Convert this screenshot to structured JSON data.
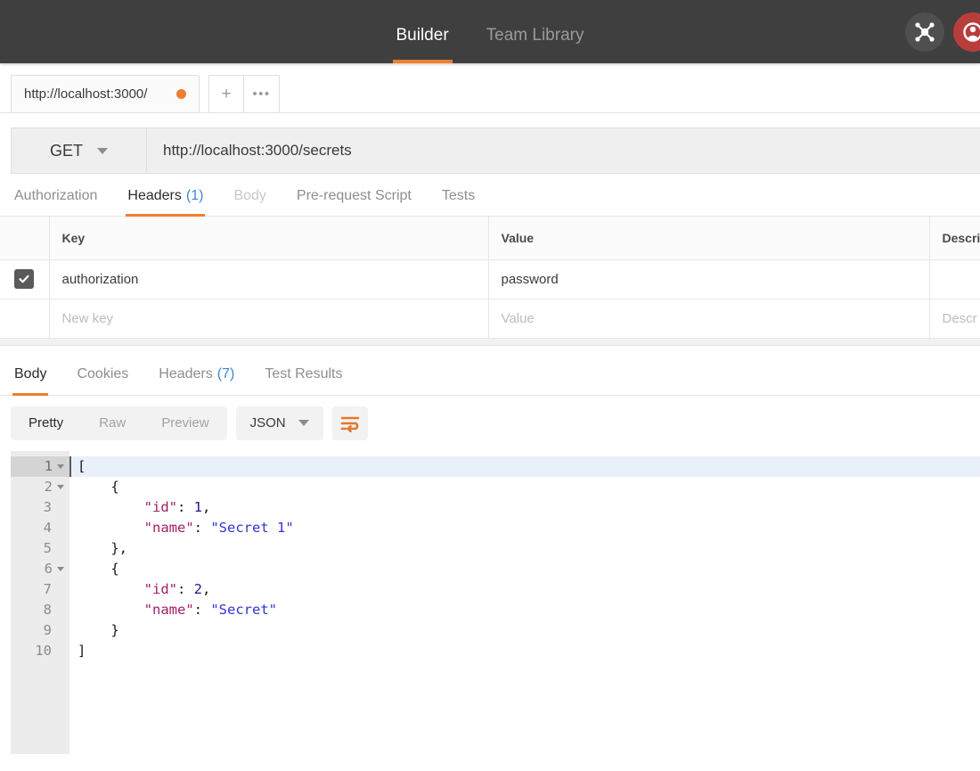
{
  "topbar": {
    "nav": [
      {
        "label": "Builder",
        "active": true
      },
      {
        "label": "Team Library",
        "active": false
      }
    ],
    "icons": [
      {
        "name": "network-graph-icon",
        "color": "#4f4f4f"
      },
      {
        "name": "user-avatar-icon",
        "color": "#b93d3d"
      }
    ],
    "accent_color": "#ef7e2f",
    "background_color": "#3f3f3f"
  },
  "request_tabs": {
    "open_tab_label": "http://localhost:3000/",
    "unsaved_indicator_color": "#ef7e2f",
    "new_tab_label": "+",
    "more_label": "•••"
  },
  "url_bar": {
    "method": "GET",
    "url": "http://localhost:3000/secrets"
  },
  "request_subtabs": [
    {
      "label": "Authorization",
      "count": "",
      "state": "normal"
    },
    {
      "label": "Headers",
      "count": "(1)",
      "state": "active"
    },
    {
      "label": "Body",
      "count": "",
      "state": "disabled"
    },
    {
      "label": "Pre-request Script",
      "count": "",
      "state": "normal"
    },
    {
      "label": "Tests",
      "count": "",
      "state": "normal"
    }
  ],
  "headers_table": {
    "columns": [
      "",
      "Key",
      "Value",
      "Descrip"
    ],
    "rows": [
      {
        "checked": true,
        "key": "authorization",
        "value": "password",
        "description": ""
      }
    ],
    "new_row": {
      "key_placeholder": "New key",
      "value_placeholder": "Value",
      "description_placeholder": "Descr"
    }
  },
  "response_tabs": [
    {
      "label": "Body",
      "count": "",
      "active": true
    },
    {
      "label": "Cookies",
      "count": "",
      "active": false
    },
    {
      "label": "Headers",
      "count": "(7)",
      "active": false
    },
    {
      "label": "Test Results",
      "count": "",
      "active": false
    }
  ],
  "response_toolbar": {
    "view_modes": [
      {
        "label": "Pretty",
        "active": true
      },
      {
        "label": "Raw",
        "active": false
      },
      {
        "label": "Preview",
        "active": false
      }
    ],
    "language": "JSON",
    "wrap_icon": "word-wrap-icon"
  },
  "response_body": {
    "line_numbers": [
      "1",
      "2",
      "3",
      "4",
      "5",
      "6",
      "7",
      "8",
      "9",
      "10"
    ],
    "foldable_lines": [
      "1",
      "2",
      "6"
    ],
    "active_line": "1",
    "lines": [
      {
        "num": "1",
        "tokens": [
          {
            "t": "p",
            "v": "["
          }
        ]
      },
      {
        "num": "2",
        "tokens": [
          {
            "t": "p",
            "v": "    {"
          }
        ]
      },
      {
        "num": "3",
        "tokens": [
          {
            "t": "k",
            "v": "        \"id\""
          },
          {
            "t": "p",
            "v": ": "
          },
          {
            "t": "n",
            "v": "1"
          },
          {
            "t": "p",
            "v": ","
          }
        ]
      },
      {
        "num": "4",
        "tokens": [
          {
            "t": "k",
            "v": "        \"name\""
          },
          {
            "t": "p",
            "v": ": "
          },
          {
            "t": "s",
            "v": "\"Secret 1\""
          }
        ]
      },
      {
        "num": "5",
        "tokens": [
          {
            "t": "p",
            "v": "    },"
          }
        ]
      },
      {
        "num": "6",
        "tokens": [
          {
            "t": "p",
            "v": "    {"
          }
        ]
      },
      {
        "num": "7",
        "tokens": [
          {
            "t": "k",
            "v": "        \"id\""
          },
          {
            "t": "p",
            "v": ": "
          },
          {
            "t": "n",
            "v": "2"
          },
          {
            "t": "p",
            "v": ","
          }
        ]
      },
      {
        "num": "8",
        "tokens": [
          {
            "t": "k",
            "v": "        \"name\""
          },
          {
            "t": "p",
            "v": ": "
          },
          {
            "t": "s",
            "v": "\"Secret\""
          }
        ]
      },
      {
        "num": "9",
        "tokens": [
          {
            "t": "p",
            "v": "    }"
          }
        ]
      },
      {
        "num": "10",
        "tokens": [
          {
            "t": "p",
            "v": "]"
          }
        ]
      }
    ]
  }
}
